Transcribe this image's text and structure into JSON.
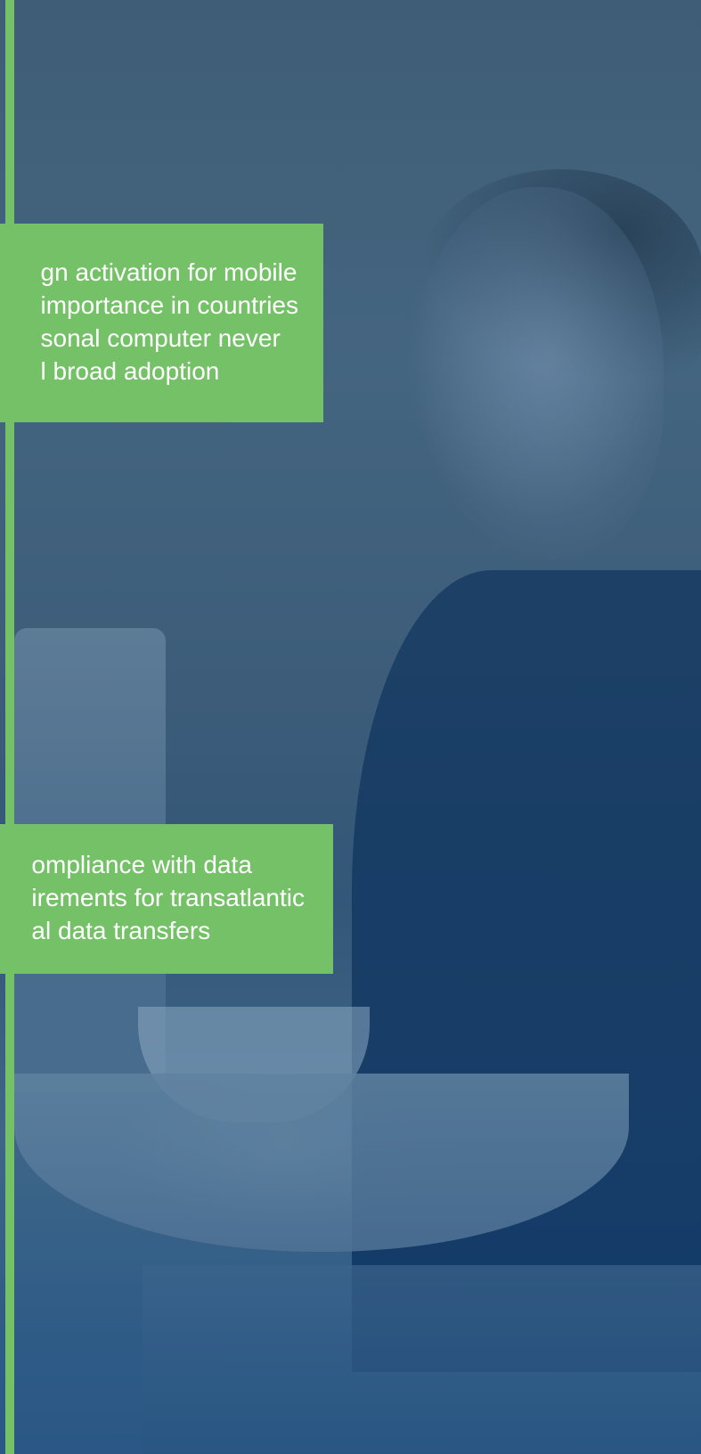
{
  "callouts": [
    {
      "lines": [
        "gn activation for mobile",
        "importance in countries",
        "sonal computer never",
        "l broad adoption"
      ]
    },
    {
      "lines": [
        "ompliance with data",
        "irements for transatlantic",
        "al data transfers"
      ]
    }
  ],
  "colors": {
    "accent_green": "#74c167",
    "overlay_blue": "#3f5d76",
    "text": "#ffffff"
  }
}
